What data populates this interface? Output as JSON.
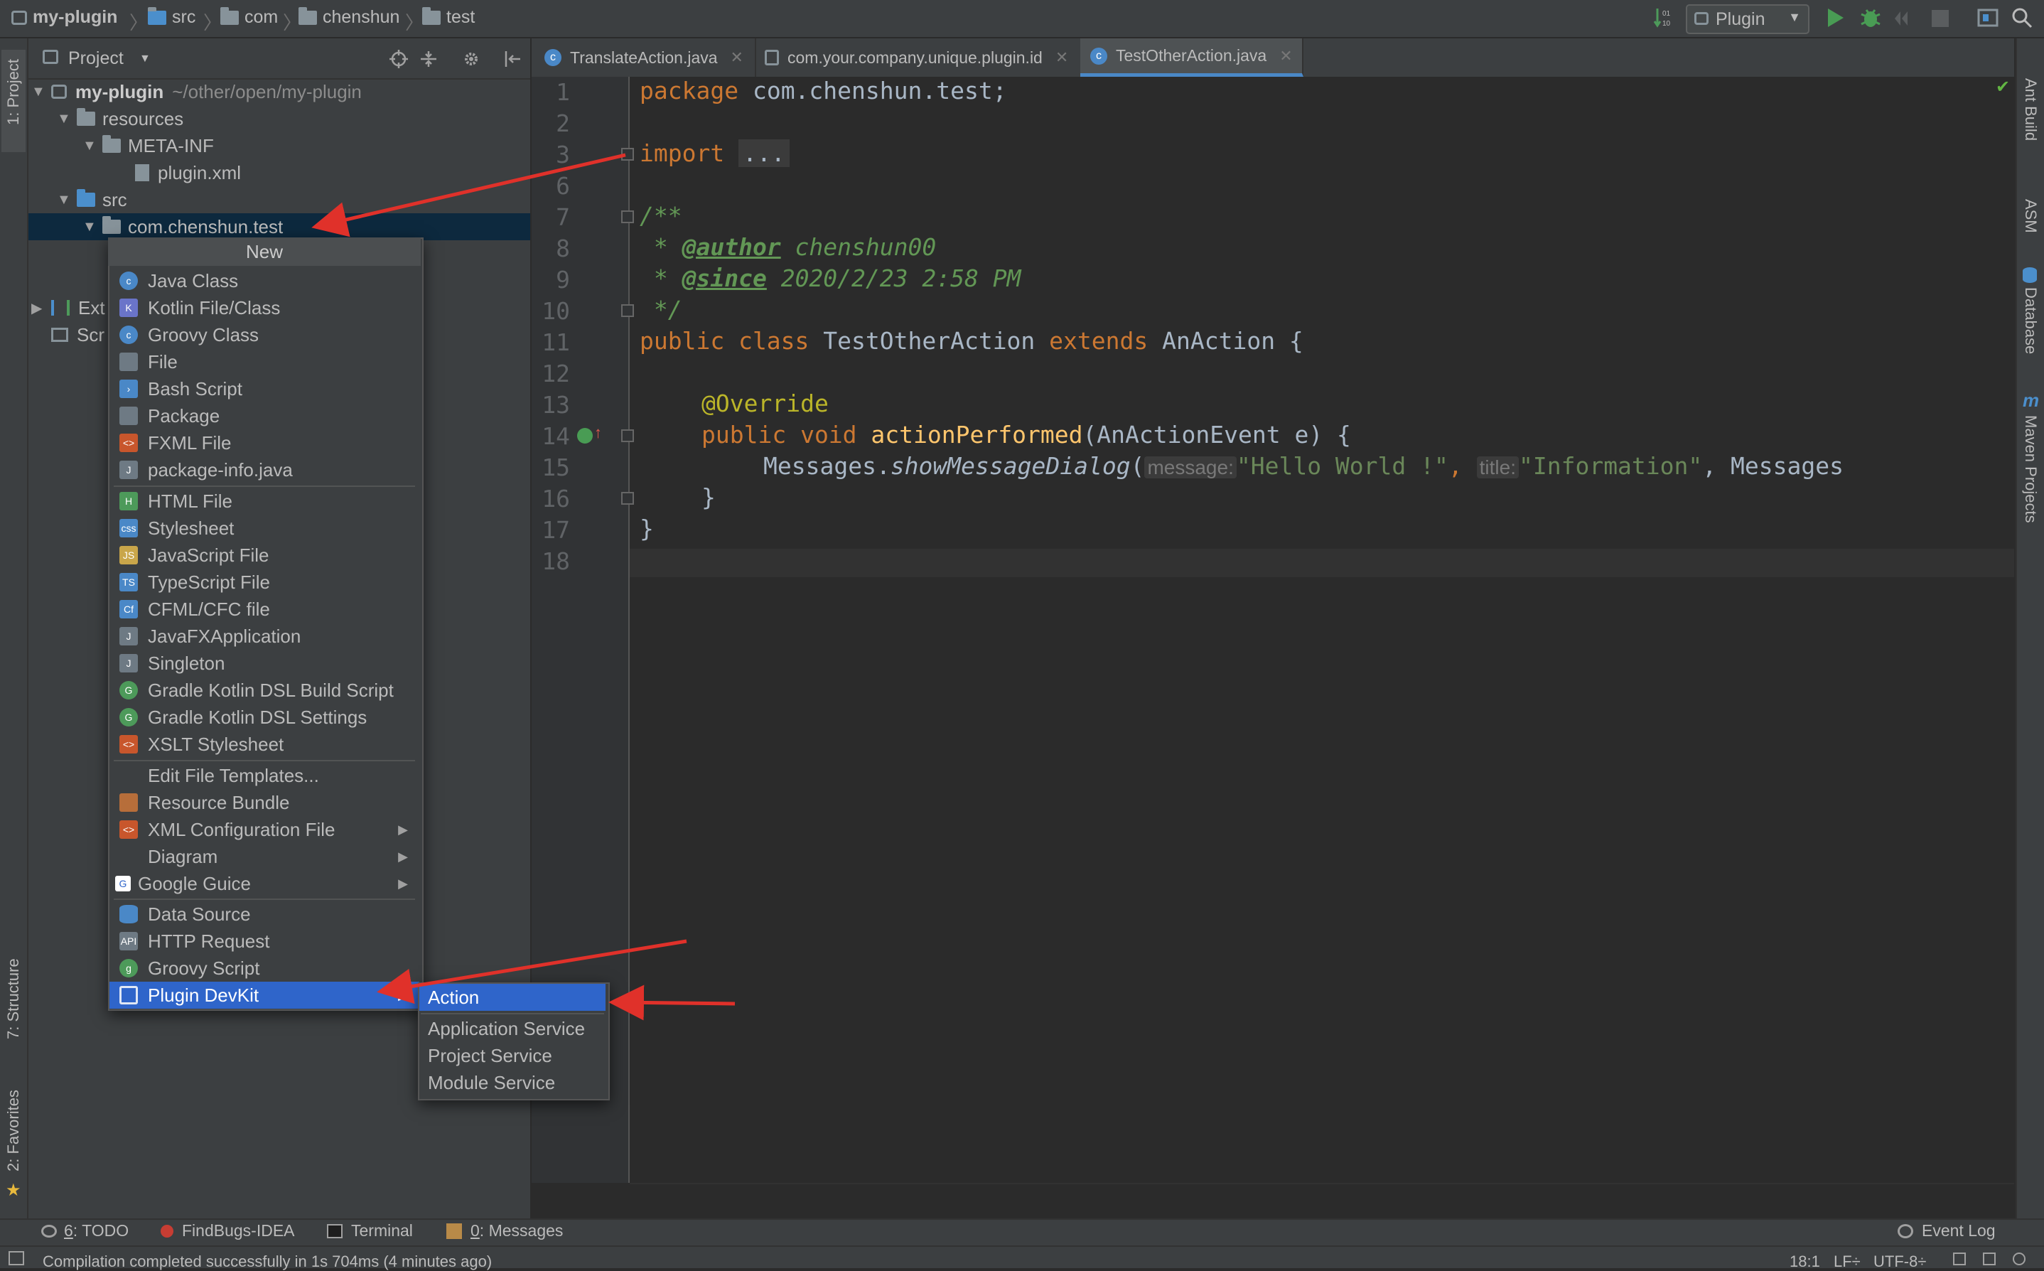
{
  "breadcrumb": [
    "my-plugin",
    "src",
    "com",
    "chenshun",
    "test"
  ],
  "run_config": {
    "label": "Plugin"
  },
  "left_tabs": {
    "project": "1: Project",
    "structure": "7: Structure",
    "favorites": "2: Favorites"
  },
  "right_tabs": {
    "ant": "Ant Build",
    "asm": "ASM",
    "database": "Database",
    "maven": "Maven Projects"
  },
  "project_panel": {
    "title": "Project",
    "tree": {
      "root_name": "my-plugin",
      "root_path": "~/other/open/my-plugin",
      "resources": "resources",
      "meta_inf": "META-INF",
      "plugin_xml": "plugin.xml",
      "src": "src",
      "package": "com.chenshun.test",
      "ext_partial": "Ext",
      "scr_partial": "Scr"
    }
  },
  "editor_tabs": [
    {
      "label": "TranslateAction.java"
    },
    {
      "label": "com.your.company.unique.plugin.id"
    },
    {
      "label": "TestOtherAction.java"
    }
  ],
  "code": {
    "line_numbers": [
      "1",
      "2",
      "3",
      "6",
      "7",
      "8",
      "9",
      "10",
      "11",
      "12",
      "13",
      "14",
      "15",
      "16",
      "17",
      "18"
    ],
    "package_kw": "package",
    "package_name": "com.chenshun.test;",
    "import_kw": "import",
    "import_fold": "...",
    "doc_open": "/**",
    "doc_star": " * ",
    "author_tag": "@author",
    "author_value": " chenshun00",
    "since_tag": "@since",
    "since_value": " 2020/2/23 2:58 PM",
    "doc_close": " */",
    "class_kw": "public class ",
    "class_name": "TestOtherAction ",
    "extends_kw": "extends ",
    "super_name": "AnAction {",
    "override": "@Override",
    "method_kw": "public void ",
    "method_name": "actionPerformed",
    "method_params": "(AnActionEvent e) {",
    "call_prefix": "Messages.",
    "call_name": "showMessageDialog",
    "call_open": "(",
    "hint_message": "message:",
    "arg1": "\"Hello World !\"",
    "comma": ", ",
    "hint_title": "title:",
    "arg2": "\"Information\"",
    "call_rest": ", Messages",
    "close_brace_inner": "}",
    "close_brace_outer": "}"
  },
  "menu": {
    "header": "New",
    "items": [
      {
        "label": "Java Class",
        "icon": "java-class-icon"
      },
      {
        "label": "Kotlin File/Class",
        "icon": "kotlin-icon"
      },
      {
        "label": "Groovy Class",
        "icon": "groovy-class-icon"
      },
      {
        "label": "File",
        "icon": "file-icon"
      },
      {
        "label": "Bash Script",
        "icon": "bash-icon"
      },
      {
        "label": "Package",
        "icon": "package-icon"
      },
      {
        "label": "FXML File",
        "icon": "fxml-icon"
      },
      {
        "label": "package-info.java",
        "icon": "java-file-icon"
      },
      {
        "label": "HTML File",
        "icon": "html-icon"
      },
      {
        "label": "Stylesheet",
        "icon": "css-icon"
      },
      {
        "label": "JavaScript File",
        "icon": "js-icon"
      },
      {
        "label": "TypeScript File",
        "icon": "ts-icon"
      },
      {
        "label": "CFML/CFC file",
        "icon": "cf-icon"
      },
      {
        "label": "JavaFXApplication",
        "icon": "javafx-icon"
      },
      {
        "label": "Singleton",
        "icon": "singleton-icon"
      },
      {
        "label": "Gradle Kotlin DSL Build Script",
        "icon": "gradle-icon"
      },
      {
        "label": "Gradle Kotlin DSL Settings",
        "icon": "gradle-icon"
      },
      {
        "label": "XSLT Stylesheet",
        "icon": "xslt-icon"
      },
      {
        "label": "Edit File Templates...",
        "icon": ""
      },
      {
        "label": "Resource Bundle",
        "icon": "resource-bundle-icon"
      },
      {
        "label": "XML Configuration File",
        "icon": "xml-icon"
      },
      {
        "label": "Diagram",
        "icon": ""
      },
      {
        "label": "Google Guice",
        "icon": "guice-icon"
      },
      {
        "label": "Data Source",
        "icon": "database-icon"
      },
      {
        "label": "HTTP Request",
        "icon": "http-icon"
      },
      {
        "label": "Groovy Script",
        "icon": "groovy-script-icon"
      },
      {
        "label": "Plugin DevKit",
        "icon": "plugin-icon"
      }
    ]
  },
  "submenu": {
    "items": [
      "Action",
      "Application Service",
      "Project Service",
      "Module Service"
    ]
  },
  "tool_windows": {
    "todo_num": "6",
    "todo": ": TODO",
    "findbugs": "FindBugs-IDEA",
    "terminal": "Terminal",
    "messages_num": "0",
    "messages": ": Messages",
    "event_log": "Event Log"
  },
  "status": {
    "message": "Compilation completed successfully in 1s 704ms (4 minutes ago)",
    "position": "18:1",
    "line_sep": "LF÷",
    "encoding": "UTF-8÷"
  },
  "colors": {
    "accent": "#2f65ca",
    "arrow": "#e0312a"
  }
}
